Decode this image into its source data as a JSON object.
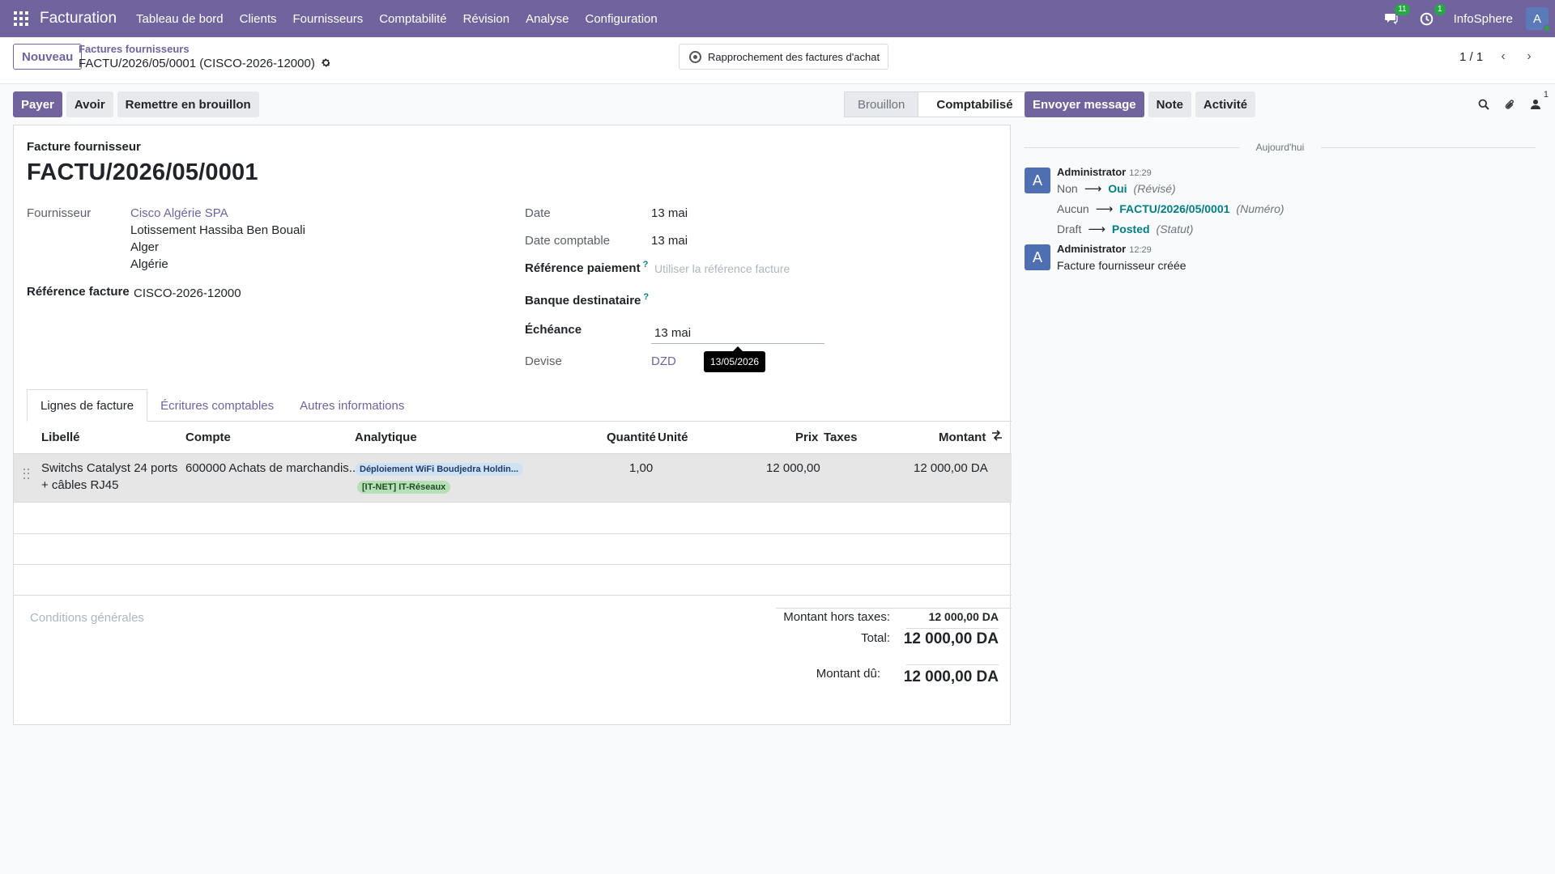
{
  "navbar": {
    "app_name": "Facturation",
    "menu": [
      "Tableau de bord",
      "Clients",
      "Fournisseurs",
      "Comptabilité",
      "Révision",
      "Analyse",
      "Configuration"
    ],
    "messages_count": "11",
    "activities_count": "1",
    "company": "InfoSphere",
    "avatar_letter": "A"
  },
  "control": {
    "new_label": "Nouveau",
    "breadcrumb_parent": "Factures fournisseurs",
    "breadcrumb_current": "FACTU/2026/05/0001 (CISCO-2026-12000)",
    "reconcile_label": "Rapprochement des factures d'achat",
    "pager": "1 / 1"
  },
  "actions": {
    "pay": "Payer",
    "credit_note": "Avoir",
    "reset_draft": "Remettre en brouillon"
  },
  "status": {
    "draft": "Brouillon",
    "posted": "Comptabilisé"
  },
  "form": {
    "doc_type": "Facture fournisseur",
    "doc_name": "FACTU/2026/05/0001",
    "vendor_label": "Fournisseur",
    "vendor_name": "Cisco Algérie SPA",
    "vendor_address": [
      "Lotissement Hassiba Ben Bouali",
      "Alger",
      "Algérie"
    ],
    "ref_label": "Référence facture",
    "ref_value": "CISCO-2026-12000",
    "date_label": "Date",
    "date_value": "13 mai",
    "acc_date_label": "Date comptable",
    "acc_date_value": "13 mai",
    "pay_ref_label": "Référence paiement",
    "pay_ref_placeholder": "Utiliser la référence facture",
    "bank_label": "Banque destinataire",
    "due_label": "Échéance",
    "due_value": "13 mai",
    "due_tooltip": "13/05/2026",
    "currency_label": "Devise",
    "currency_value": "DZD",
    "help_mark": "?"
  },
  "tabs": [
    "Lignes de facture",
    "Écritures comptables",
    "Autres informations"
  ],
  "table": {
    "headers": {
      "label": "Libellé",
      "account": "Compte",
      "analytic": "Analytique",
      "quantity": "Quantité",
      "unit": "Unité",
      "price": "Prix",
      "taxes": "Taxes",
      "amount": "Montant"
    },
    "rows": [
      {
        "label_line1": "Switchs Catalyst 24 ports",
        "label_line2": "+ câbles RJ45",
        "account": "600000 Achats de marchandis...",
        "tag1": "Déploiement WiFi Boudjedra Holdin...",
        "tag2": "[IT-NET] IT-Réseaux",
        "quantity": "1,00",
        "price": "12 000,00",
        "amount": "12 000,00 DA"
      }
    ]
  },
  "totals": {
    "terms_placeholder": "Conditions générales",
    "untaxed_label": "Montant hors taxes:",
    "untaxed_value": "12 000,00 DA",
    "total_label": "Total:",
    "total_value": "12 000,00 DA",
    "due_label": "Montant dû:",
    "due_value": "12 000,00 DA"
  },
  "chatter": {
    "send_message": "Envoyer message",
    "note": "Note",
    "activity": "Activité",
    "followers_count": "1",
    "today": "Aujourd'hui",
    "messages": [
      {
        "author": "Administrator",
        "time": "12:29",
        "changes": [
          {
            "old": "Non",
            "new": "Oui",
            "field": "(Révisé)"
          },
          {
            "old": "Aucun",
            "new": "FACTU/2026/05/0001",
            "field": "(Numéro)"
          },
          {
            "old": "Draft",
            "new": "Posted",
            "field": "(Statut)"
          }
        ]
      },
      {
        "author": "Administrator",
        "time": "12:29",
        "body": "Facture fournisseur créée"
      }
    ]
  },
  "colors": {
    "brand": "#71639e",
    "link_teal": "#017e84"
  }
}
